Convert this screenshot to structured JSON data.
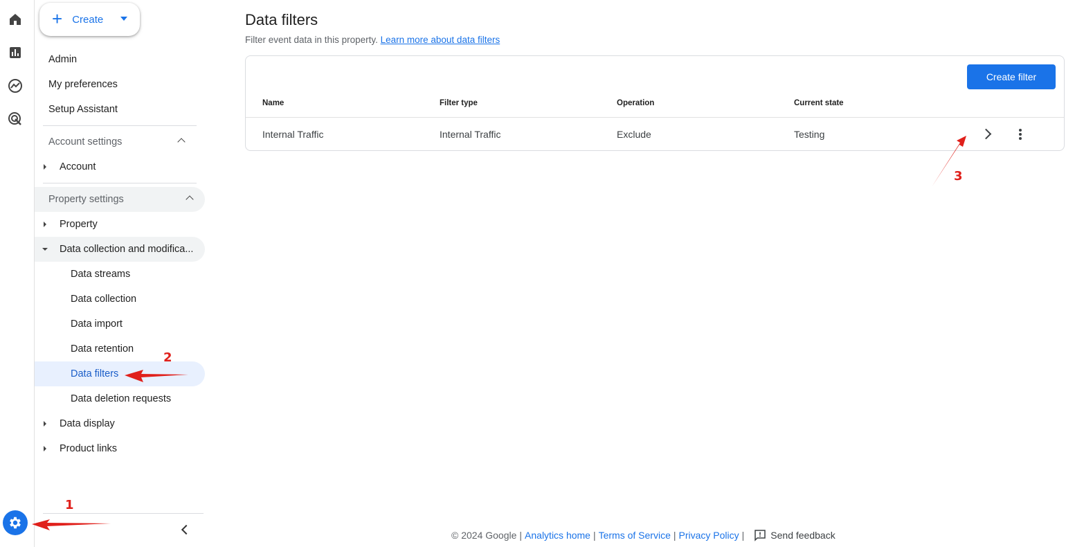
{
  "rail": {
    "icons": [
      "home-icon",
      "reports-icon",
      "explore-icon",
      "advertising-icon"
    ],
    "admin_icon": "gear-icon"
  },
  "nav": {
    "create_label": "Create",
    "top_items": [
      "Admin",
      "My preferences",
      "Setup Assistant"
    ],
    "account_settings": {
      "label": "Account settings",
      "items": [
        "Account"
      ]
    },
    "property_settings": {
      "label": "Property settings",
      "property": "Property",
      "data_collection": "Data collection and modifica...",
      "sub_items": [
        "Data streams",
        "Data collection",
        "Data import",
        "Data retention",
        "Data filters",
        "Data deletion requests"
      ],
      "data_display": "Data display",
      "product_links": "Product links"
    }
  },
  "main": {
    "title": "Data filters",
    "subtitle": "Filter event data in this property.",
    "learn_more": "Learn more about data filters",
    "create_filter": "Create filter",
    "columns": [
      "Name",
      "Filter type",
      "Operation",
      "Current state"
    ],
    "rows": [
      {
        "name": "Internal Traffic",
        "filter_type": "Internal Traffic",
        "operation": "Exclude",
        "state": "Testing"
      }
    ]
  },
  "footer": {
    "copyright": "© 2024 Google",
    "links": [
      "Analytics home",
      "Terms of Service",
      "Privacy Policy"
    ],
    "feedback": "Send feedback"
  },
  "annotations": [
    "1",
    "2",
    "3"
  ],
  "colors": {
    "accent": "#1a73e8",
    "active_bg": "#e8f0fe",
    "annotation": "#e0201b"
  }
}
